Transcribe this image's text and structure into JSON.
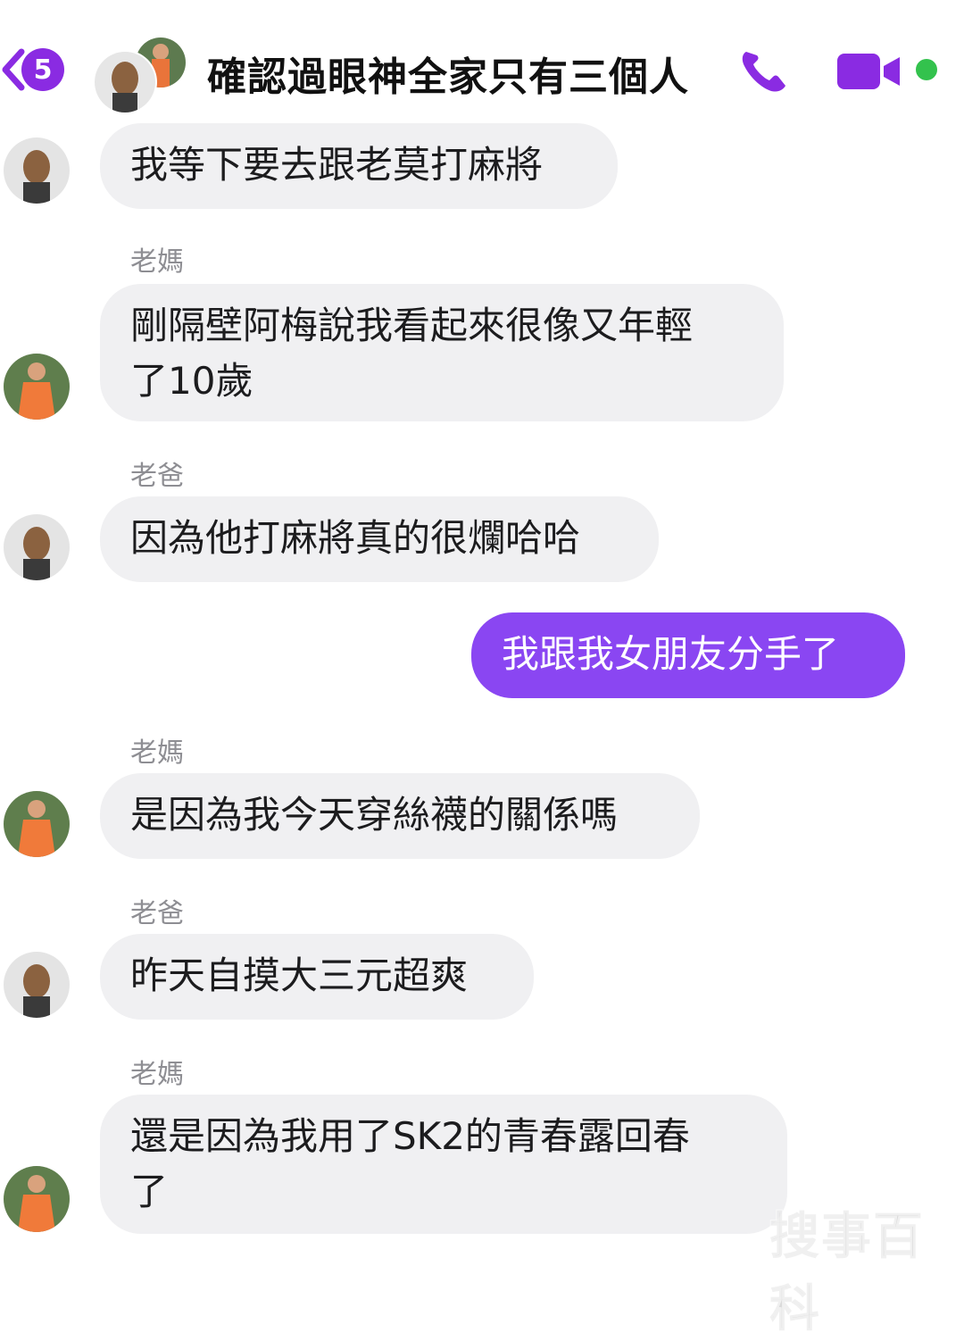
{
  "header": {
    "back_badge_count": "5",
    "title": "確認過眼神全家只有三個人",
    "icons": [
      "chevron-left-icon",
      "phone-icon",
      "video-camera-icon"
    ],
    "accent_color": "#8a2be2",
    "online_color": "#33c24d"
  },
  "messages": [
    {
      "sender": "",
      "text": "我等下要去跟老莫打麻將",
      "from": "dad"
    },
    {
      "sender": "老媽",
      "text": "剛隔壁阿梅說我看起來很像又年輕\n了10歲",
      "from": "mom"
    },
    {
      "sender": "老爸",
      "text": "因為他打麻將真的很爛哈哈",
      "from": "dad"
    },
    {
      "sender": "",
      "text": "我跟我女朋友分手了",
      "from": "me"
    },
    {
      "sender": "老媽",
      "text": "是因為我今天穿絲襪的關係嗎",
      "from": "mom"
    },
    {
      "sender": "老爸",
      "text": "昨天自摸大三元超爽",
      "from": "dad"
    },
    {
      "sender": "老媽",
      "text": "還是因為我用了SK2的青春露回春\n了",
      "from": "mom"
    }
  ],
  "watermark": "搜事百科",
  "colors": {
    "incoming_bubble": "#f0f0f2",
    "outgoing_bubble": "#8a46f2",
    "sender_label": "#8e8e93"
  }
}
